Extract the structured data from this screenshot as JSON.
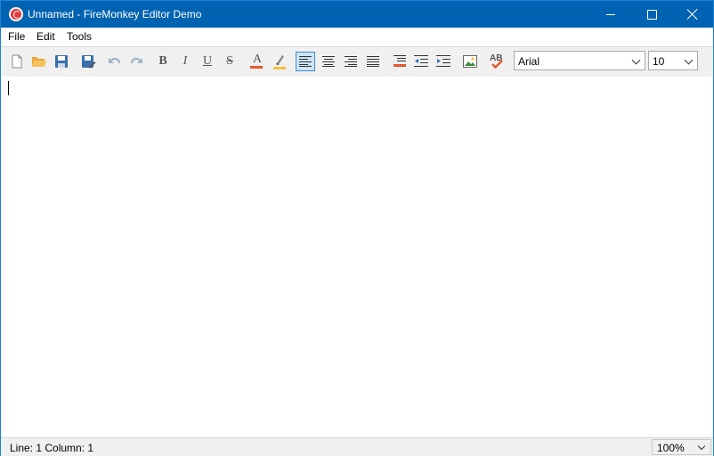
{
  "window": {
    "title": "Unnamed - FireMonkey Editor Demo"
  },
  "menu": {
    "items": [
      "File",
      "Edit",
      "Tools"
    ]
  },
  "toolbar": {
    "buttons": [
      "new-file-icon",
      "open-folder-icon",
      "save-icon",
      "save-as-icon",
      "undo-icon",
      "redo-icon",
      "bold-icon",
      "italic-icon",
      "underline-icon",
      "strikethrough-icon",
      "font-color-icon",
      "highlight-icon",
      "align-left-icon",
      "align-center-icon",
      "align-right-icon",
      "justify-icon",
      "bullets-icon",
      "outdent-icon",
      "indent-icon",
      "insert-image-icon",
      "spell-check-icon"
    ],
    "bold_label": "B",
    "italic_label": "I",
    "underline_label": "U",
    "strike_label": "S",
    "font_color_label": "A",
    "spell_label": "AB",
    "font": "Arial",
    "size": "10"
  },
  "colors": {
    "titlebar": "#0063b1",
    "font_color": "#e8572a",
    "highlight": "#f3c237",
    "active_toggle": "#cce4f7"
  },
  "status": {
    "position": "Line: 1 Column: 1",
    "zoom": "100%"
  }
}
